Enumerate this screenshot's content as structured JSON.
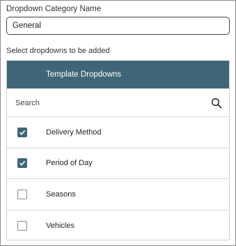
{
  "category_name": {
    "label": "Dropdown Category Name",
    "value": "General"
  },
  "select_label": "Select dropdowns to be added",
  "panel": {
    "header": "Template Dropdowns",
    "search": {
      "placeholder": "Search",
      "icon": "search-icon"
    },
    "items": [
      {
        "label": "Delivery Method",
        "checked": true
      },
      {
        "label": "Period of Day",
        "checked": true
      },
      {
        "label": "Seasons",
        "checked": false
      },
      {
        "label": "Vehicles",
        "checked": false
      }
    ],
    "accent_color": "#3f6677"
  }
}
